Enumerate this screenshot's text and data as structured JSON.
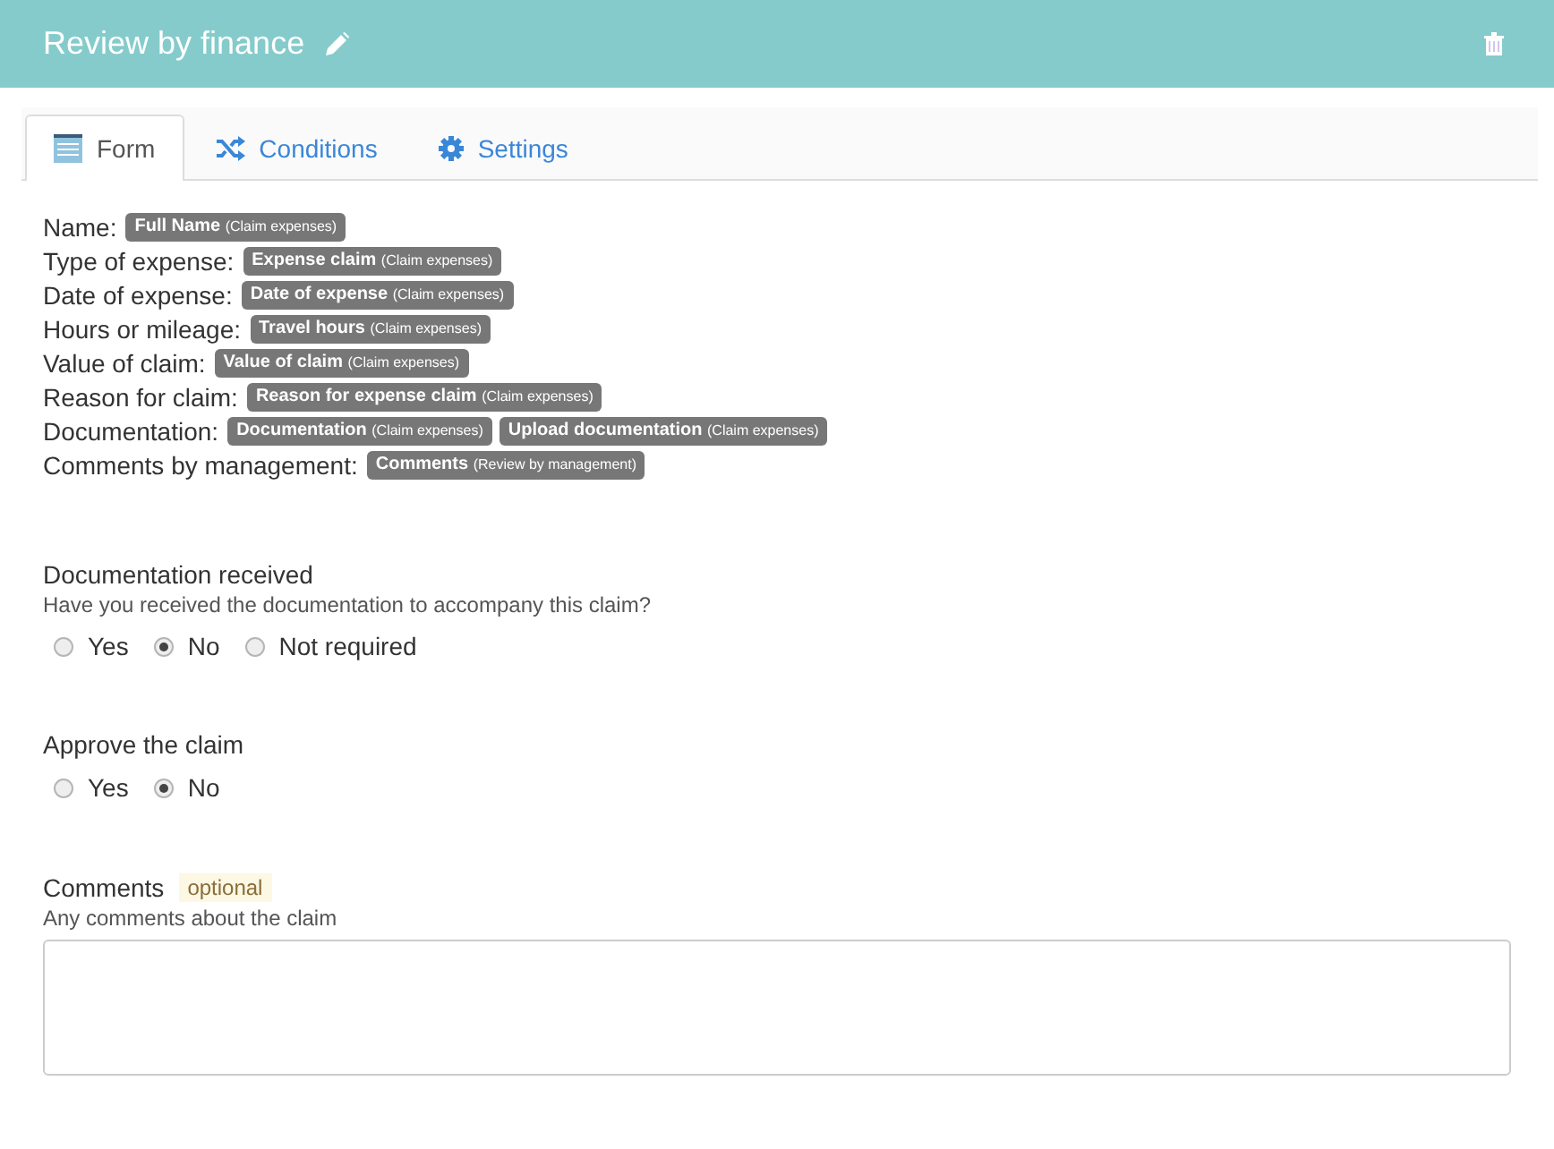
{
  "header": {
    "title": "Review by finance"
  },
  "tabs": [
    {
      "label": "Form",
      "selected": true
    },
    {
      "label": "Conditions",
      "selected": false
    },
    {
      "label": "Settings",
      "selected": false
    }
  ],
  "fields": [
    {
      "label": "Name:",
      "tags": [
        {
          "field": "Full Name",
          "source": "(Claim expenses)"
        }
      ]
    },
    {
      "label": "Type of expense:",
      "tags": [
        {
          "field": "Expense claim",
          "source": "(Claim expenses)"
        }
      ]
    },
    {
      "label": "Date of expense:",
      "tags": [
        {
          "field": "Date of expense",
          "source": "(Claim expenses)"
        }
      ]
    },
    {
      "label": "Hours or mileage:",
      "tags": [
        {
          "field": "Travel hours",
          "source": "(Claim expenses)"
        }
      ]
    },
    {
      "label": "Value of claim:",
      "tags": [
        {
          "field": "Value of claim",
          "source": "(Claim expenses)"
        }
      ]
    },
    {
      "label": "Reason for claim:",
      "tags": [
        {
          "field": "Reason for expense claim",
          "source": "(Claim expenses)"
        }
      ]
    },
    {
      "label": "Documentation:",
      "tags": [
        {
          "field": "Documentation",
          "source": "(Claim expenses)"
        },
        {
          "field": "Upload documentation",
          "source": "(Claim expenses)"
        }
      ]
    },
    {
      "label": "Comments by management:",
      "tags": [
        {
          "field": "Comments",
          "source": "(Review by management)"
        }
      ]
    }
  ],
  "questions": [
    {
      "title": "Documentation received",
      "hint": "Have you received the documentation to accompany this claim?",
      "options": [
        {
          "label": "Yes",
          "selected": false
        },
        {
          "label": "No",
          "selected": true
        },
        {
          "label": "Not required",
          "selected": false
        }
      ]
    },
    {
      "title": "Approve the claim",
      "options": [
        {
          "label": "Yes",
          "selected": false
        },
        {
          "label": "No",
          "selected": true
        }
      ]
    }
  ],
  "comments": {
    "label": "Comments",
    "badge": "optional",
    "hint": "Any comments about the claim"
  }
}
